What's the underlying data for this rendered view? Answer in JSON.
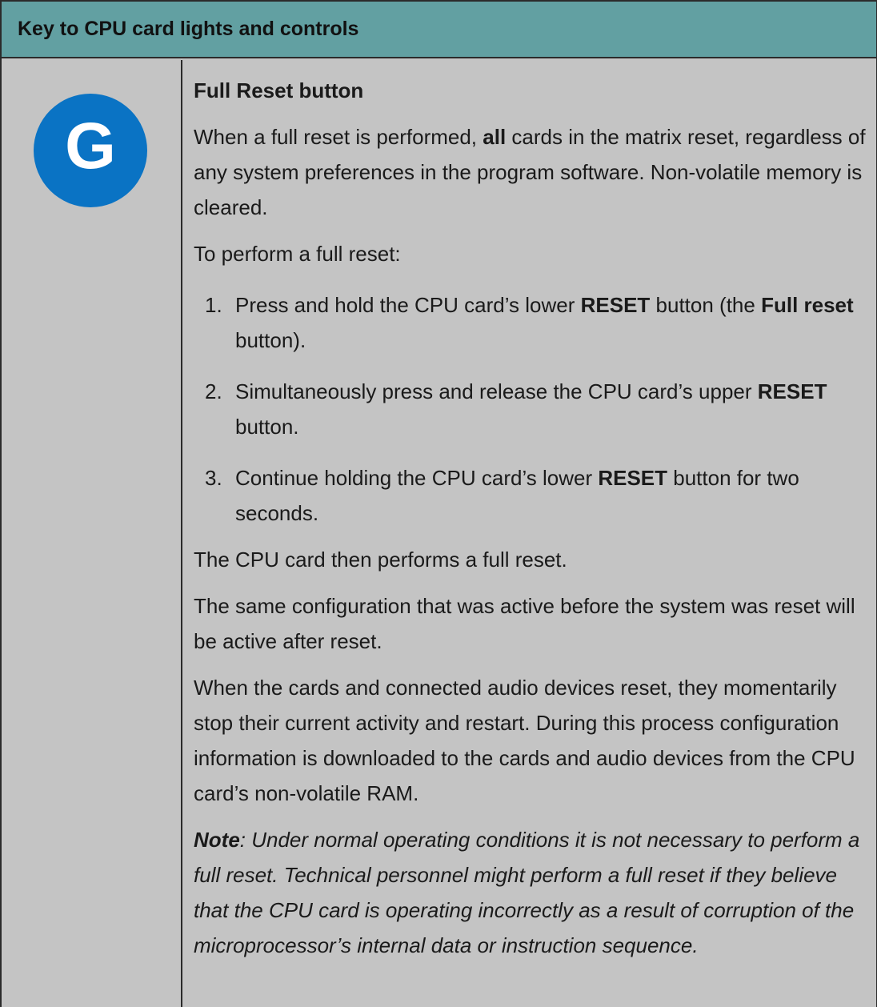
{
  "header": {
    "title": "Key to CPU card lights and controls"
  },
  "badge": {
    "letter": "G",
    "color": "#0a73c4"
  },
  "section": {
    "title": "Full Reset button",
    "intro": {
      "before": "When a full reset is performed, ",
      "bold": "all",
      "after": " cards in the matrix reset, regardless of any system preferences in the program software. Non-volatile memory is cleared."
    },
    "lead": "To perform a full reset:",
    "steps": [
      {
        "num": "1.",
        "t1": "Press and hold the CPU card’s lower ",
        "b1": "RESET",
        "t2": " button (the ",
        "b2": "Full reset",
        "t3": " button)."
      },
      {
        "num": "2.",
        "t1": "Simultaneously press and release the CPU card’s upper ",
        "b1": "RESET",
        "t2": " button."
      },
      {
        "num": "3.",
        "t1": "Continue holding the CPU card’s lower ",
        "b1": "RESET",
        "t2": " button for two seconds."
      }
    ],
    "result": "The CPU card then performs a full reset.",
    "config": "The same configuration that was active before the system was reset will be active after reset.",
    "restart": "When the cards and connected audio devices reset, they momentarily stop their current activity and restart. During this process configuration information is downloaded to the cards and audio devices from the CPU card’s non-volatile RAM.",
    "note": {
      "label": "Note",
      "text": ": Under normal operating conditions it is not necessary to perform a full reset. Technical personnel might perform a full reset if they believe that the CPU card is operating incorrectly as a result of corruption of the microprocessor’s internal data or instruction sequence."
    }
  }
}
